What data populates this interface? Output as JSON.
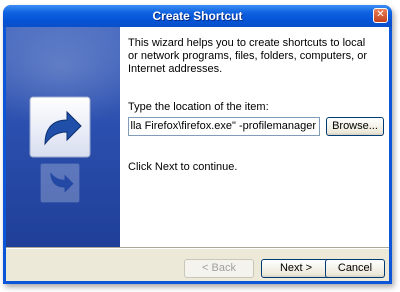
{
  "window": {
    "title": "Create Shortcut"
  },
  "wizard": {
    "intro": "This wizard helps you to create shortcuts to local or network programs, files, folders, computers, or Internet addresses.",
    "location_label": "Type the location of the item:",
    "location_value": "lla Firefox\\firefox.exe\" -profilemanager",
    "browse_label": "Browse...",
    "hint": "Click Next to continue."
  },
  "buttons": {
    "back": "< Back",
    "next": "Next >",
    "cancel": "Cancel"
  },
  "icons": {
    "close": "close-icon",
    "shortcut": "shortcut-arrow-icon"
  },
  "colors": {
    "titlebar": "#0553d6",
    "sidepanel": "#2b4fae",
    "dialog_bg": "#ece9d8"
  }
}
